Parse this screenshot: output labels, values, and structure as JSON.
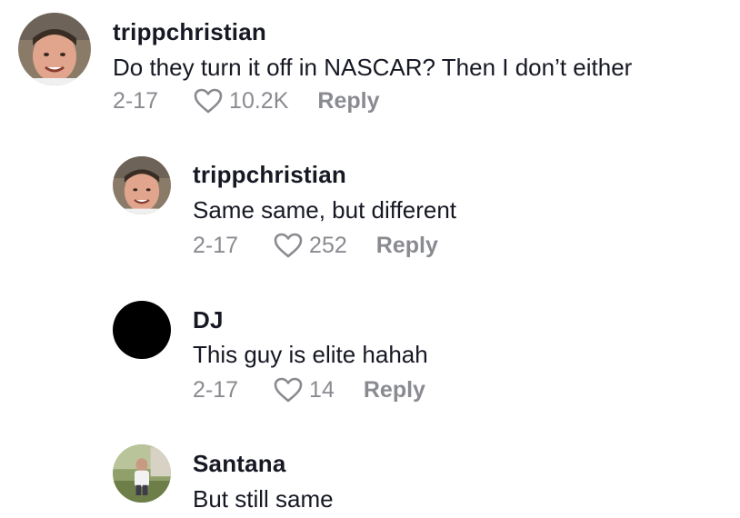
{
  "comments": [
    {
      "username": "trippchristian",
      "text": "Do they turn it off in NASCAR? Then I don’t either",
      "date": "2-17",
      "likes": "10.2K",
      "reply_label": "Reply",
      "avatar_icon": "face-photo-icon"
    },
    {
      "username": "trippchristian",
      "text": "Same same, but different",
      "date": "2-17",
      "likes": "252",
      "reply_label": "Reply",
      "avatar_icon": "face-photo-icon"
    },
    {
      "username": "DJ",
      "text": "This guy is elite hahah",
      "date": "2-17",
      "likes": "14",
      "reply_label": "Reply",
      "avatar_icon": "black-circle-avatar"
    },
    {
      "username": "Santana",
      "text": "But still same",
      "avatar_icon": "photo-avatar"
    }
  ],
  "colors": {
    "text": "#161823",
    "meta": "#8a8b91"
  }
}
